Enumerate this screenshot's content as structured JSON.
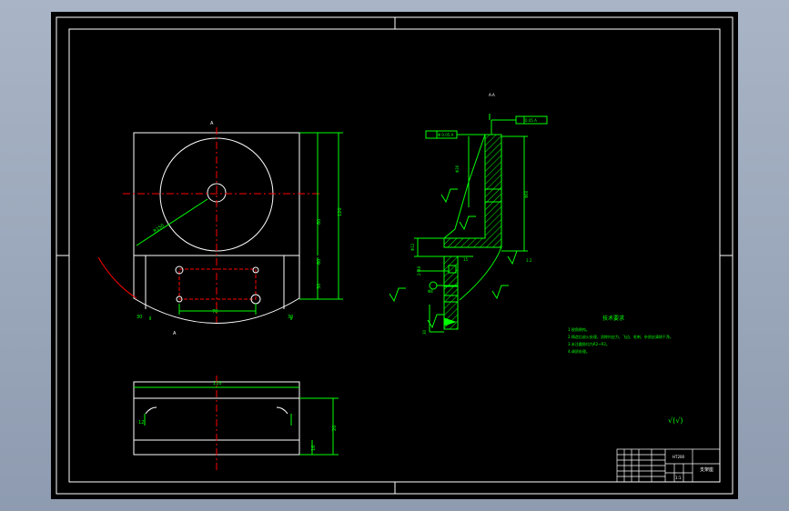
{
  "colors": {
    "canvas": "#000000",
    "frame": "#ffffff",
    "dimension": "#00ff00",
    "centerline": "#ff0000",
    "hatch": "#00ff00"
  },
  "drawing": {
    "section_label": "A-A",
    "view_marks": {
      "top": "A",
      "bottom": "A"
    },
    "dims_top": {
      "overall_height": "120",
      "inner_height": "80",
      "half": "60",
      "edge": "30",
      "foot_left": "30",
      "foot_right": "30",
      "hole_span": "70",
      "radius": "R150"
    },
    "dims_bottom": {
      "overall_width": "110",
      "height": "20",
      "right": "16",
      "left_step": "12"
    },
    "section_dims": {
      "d1": "Φ 0.05 A",
      "d2": "0.05 A",
      "v1": "Φ30",
      "v2": "Φ60",
      "v3": "Φ12",
      "v4": "Φ8",
      "v5": "15",
      "v6": "2-M8",
      "v7": "30",
      "roughness": "3.2"
    }
  },
  "notes": {
    "title": "技术要求",
    "items": [
      "1.锐角倒钝。",
      "2.铸造后退火处理，消除内应力，飞边、毛刺、杂质应清除干净。",
      "3.未注圆角均为R2~R3。",
      "4.调质处理。"
    ]
  },
  "roughness_symbol": "√(√)",
  "title_block": {
    "part_name": "支架座",
    "material": "HT200",
    "scale": "1:1"
  }
}
